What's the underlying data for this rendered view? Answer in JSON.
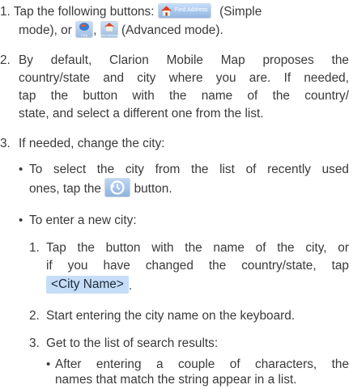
{
  "step1": {
    "number": "1.",
    "text_before": "Tap the following buttons:",
    "find_address_label": "Find Address",
    "text_simple": "(Simple",
    "text_mode_or": "mode), or",
    "find_small_label": "Find",
    "comma": ",",
    "find_address_small_label": "Find Address",
    "text_advanced": "(Advanced mode)."
  },
  "step2": {
    "number": "2.",
    "lines": [
      "By default, Clarion Mobile Map proposes the",
      "country/state and city where you are. If needed,",
      "tap the button with the name of the country/",
      "state, and select a different one from the list."
    ]
  },
  "step3": {
    "number": "3.",
    "text": "If needed, change the city:",
    "bullet1": {
      "line1": "To select the city from the list of recently used",
      "line2_before": "ones, tap the",
      "line2_after": "button."
    },
    "bullet2": {
      "text": "To enter a new city:",
      "sub1": {
        "number": "1.",
        "line1": "Tap the button with the name of the city, or",
        "line2": "if you have changed the country/state, tap",
        "city_button_label": "<City Name>",
        "line3_after": "."
      },
      "sub2": {
        "number": "2.",
        "text": "Start entering the city name on the keyboard."
      },
      "sub3": {
        "number": "3.",
        "text": "Get to the list of search results:",
        "bullet": {
          "line1": "After entering a couple of characters, the",
          "line2": "names that match the string appear in a list."
        }
      }
    }
  },
  "colors": {
    "text": "#3a3a3a",
    "button_blue": "#c6ddf7",
    "house_roof": "#d9441e"
  }
}
